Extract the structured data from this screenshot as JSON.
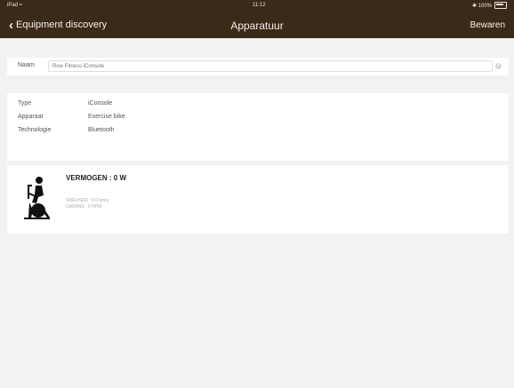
{
  "status_bar": {
    "left": "iPad ≈",
    "time": "11:12",
    "right": "✱ 100%"
  },
  "nav": {
    "back_label": "Equipment discovery",
    "title": "Apparatuur",
    "save_label": "Bewaren"
  },
  "name_field": {
    "label": "Naam",
    "value": "Row Fitness iConsole"
  },
  "info": {
    "rows": [
      {
        "label": "Type",
        "value": "iConsole"
      },
      {
        "label": "Apparaat",
        "value": "Exercise bike"
      },
      {
        "label": "Technologie",
        "value": "Bluetooth"
      }
    ]
  },
  "device": {
    "icon": "exercise-bike-icon",
    "power": "VERMOGEN : 0 W",
    "speed": "SNELHEID : 0.0 km/u",
    "cadence": "CADANS : 0 RPM"
  },
  "colors": {
    "header_bg": "#3c2a19",
    "page_bg": "#f2f2f4"
  }
}
